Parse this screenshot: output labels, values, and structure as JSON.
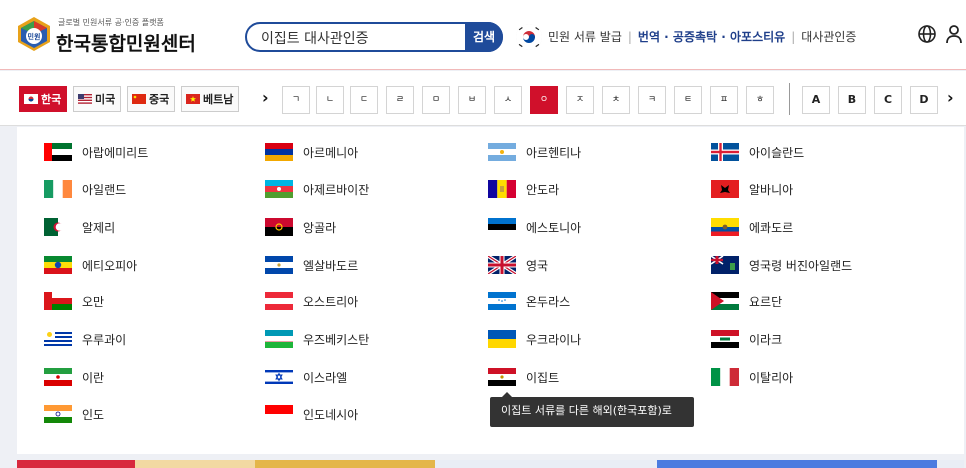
{
  "header": {
    "logo_badge": "민원",
    "logo_sub": "글로벌 민원서류 공·인증 플랫폼",
    "logo_main": "한국통합민원센터",
    "search": {
      "value": "이집트 대사관인증",
      "button": "검색"
    },
    "links": {
      "issue": "민원 서류 발급",
      "translate": "번역 · 공증촉탁 · 아포스티유",
      "embassy": "대사관인증"
    },
    "globe_icon": "globe-icon",
    "user_icon": "user-icon"
  },
  "lang_tabs": [
    {
      "label": "한국",
      "active": true
    },
    {
      "label": "미국",
      "active": false
    },
    {
      "label": "중국",
      "active": false
    },
    {
      "label": "베트남",
      "active": false
    }
  ],
  "consonants": [
    "ㄱ",
    "ㄴ",
    "ㄷ",
    "ㄹ",
    "ㅁ",
    "ㅂ",
    "ㅅ",
    "ㅇ",
    "ㅈ",
    "ㅊ",
    "ㅋ",
    "ㅌ",
    "ㅍ",
    "ㅎ"
  ],
  "active_consonant": "ㅇ",
  "alphabet": [
    "A",
    "B",
    "C",
    "D"
  ],
  "countries": [
    [
      "아랍에미리트",
      "아르메니아",
      "아르헨티나",
      "아이슬란드"
    ],
    [
      "아일랜드",
      "아제르바이잔",
      "안도라",
      "알바니아"
    ],
    [
      "알제리",
      "앙골라",
      "에스토니아",
      "에콰도르"
    ],
    [
      "에티오피아",
      "엘살바도르",
      "영국",
      "영국령 버진아일랜드"
    ],
    [
      "오만",
      "오스트리아",
      "온두라스",
      "요르단"
    ],
    [
      "우루과이",
      "우즈베키스탄",
      "우크라이나",
      "이라크"
    ],
    [
      "이란",
      "이스라엘",
      "이집트",
      "이탈리아"
    ],
    [
      "인도",
      "인도네시아"
    ]
  ],
  "tooltip": "이집트 서류를 다른 해외(한국포함)로"
}
